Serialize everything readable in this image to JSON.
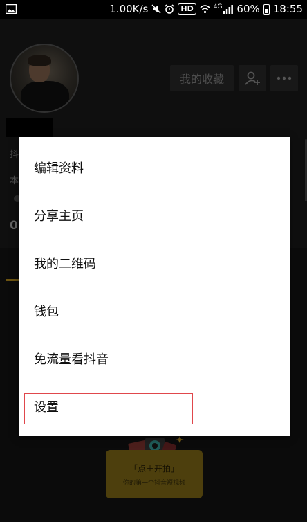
{
  "status_bar": {
    "speed": "1.00K/s",
    "hd": "HD",
    "network": "4G",
    "battery": "60%",
    "time": "18:55"
  },
  "profile": {
    "favorites_button": "我的收藏",
    "peek_text_1": "抖",
    "peek_text_2": "本",
    "peek_number": "0"
  },
  "menu": {
    "items": [
      {
        "label": "编辑资料"
      },
      {
        "label": "分享主页"
      },
      {
        "label": "我的二维码"
      },
      {
        "label": "钱包"
      },
      {
        "label": "免流量看抖音"
      },
      {
        "label": "设置"
      }
    ],
    "highlight_color": "#e0474c"
  },
  "promo": {
    "title": "「点＋开拍」",
    "subtitle": "你的第一个抖音短视频"
  }
}
